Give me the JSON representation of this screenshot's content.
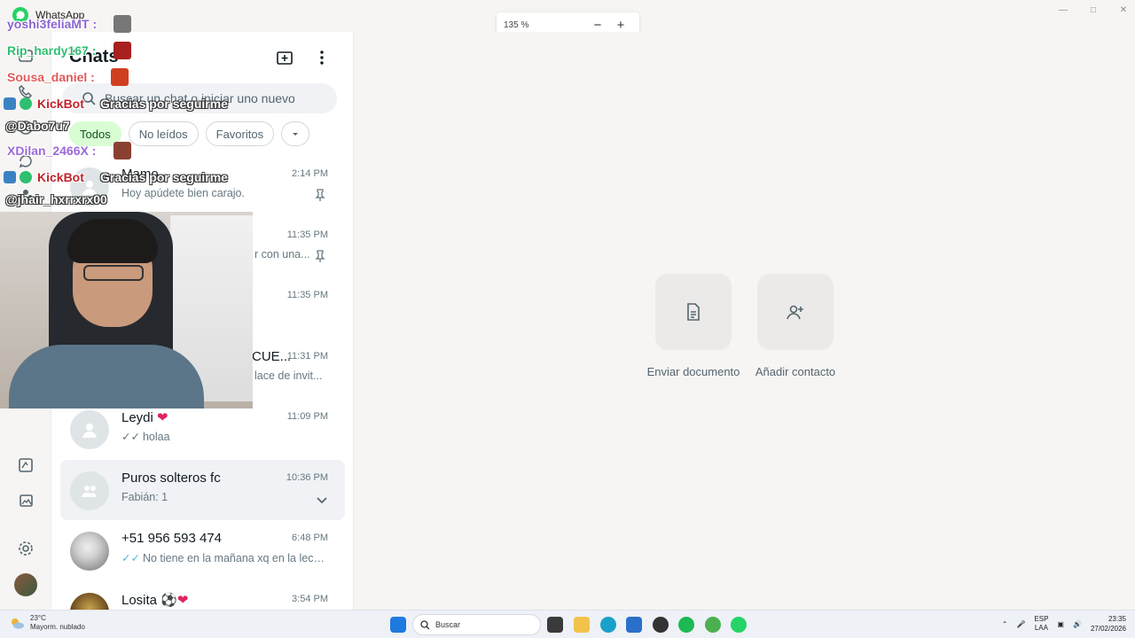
{
  "window": {
    "app_title": "WhatsApp",
    "zoom": "135 %",
    "zoom_out": "−",
    "zoom_in": "+"
  },
  "panel": {
    "title": "Chats",
    "search_placeholder": "Buscar un chat o iniciar uno nuevo",
    "filters": [
      "Todos",
      "No leídos",
      "Favoritos"
    ]
  },
  "chats": [
    {
      "name": "Mamo",
      "time": "2:14 PM",
      "message": "Hoy apúdete bien carajo."
    },
    {
      "name": "",
      "time": "11:35 PM",
      "message": "r con una..."
    },
    {
      "name": "",
      "time": "11:35 PM",
      "message": ""
    },
    {
      "name": "CUE...",
      "time": "11:31 PM",
      "message": "lace de invit..."
    },
    {
      "name": "Leydi",
      "time": "11:09 PM",
      "message": "holaa"
    },
    {
      "name": "Puros solteros fc",
      "time": "10:36 PM",
      "message": "Fabián: 1"
    },
    {
      "name": "+51 956 593 474",
      "time": "6:48 PM",
      "message": "No tiene en la mañana xq en la lech..."
    },
    {
      "name": "Losita",
      "time": "3:54 PM",
      "message": ""
    }
  ],
  "main": {
    "actions": [
      {
        "label": "Enviar documento"
      },
      {
        "label": "Añadir contacto"
      }
    ]
  },
  "overlay_chat": [
    {
      "text": "yoshi3feliaMT :"
    },
    {
      "text": "Rip_hardy167 :"
    },
    {
      "text": "Sousa_daniel :"
    },
    {
      "text": "KickBot"
    },
    {
      "text": "Gracias por seguirme"
    },
    {
      "text": "@Dabo7u7"
    },
    {
      "text": "XDilan_2466X :"
    },
    {
      "text": "KickBot"
    },
    {
      "text": "Gracias por seguirme"
    },
    {
      "text": "@jhair_hxrrxrx00"
    }
  ],
  "taskbar": {
    "weather_temp": "23°C",
    "weather_desc": "Mayorm. nublado",
    "search": "Buscar",
    "lang_top": "ESP",
    "lang_bottom": "LAA",
    "time": "23:35",
    "date": "27/02/2026"
  }
}
